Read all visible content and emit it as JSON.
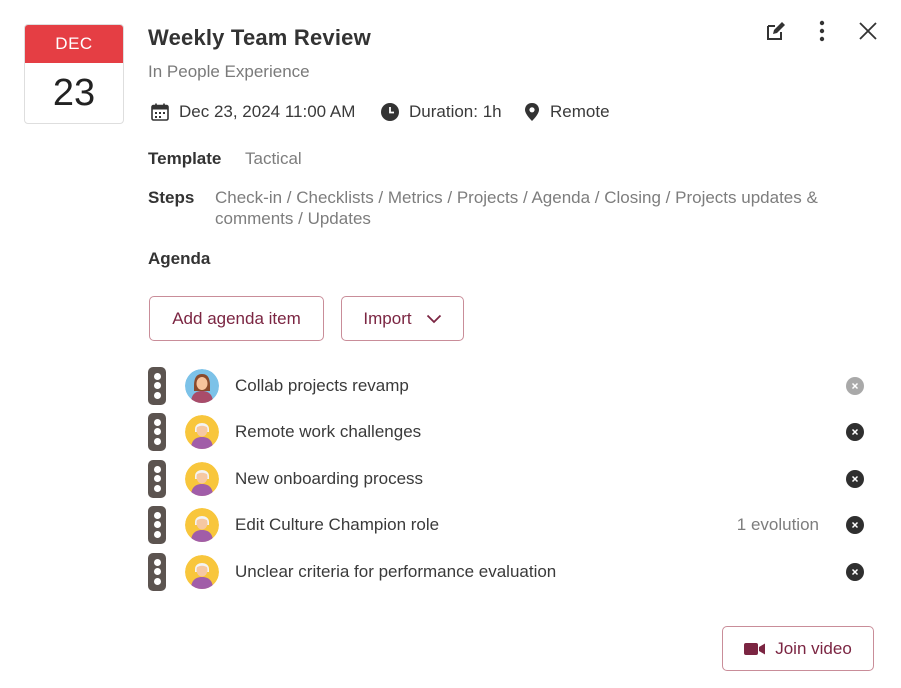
{
  "calendar": {
    "month": "DEC",
    "day": "23"
  },
  "meeting": {
    "title": "Weekly Team Review",
    "subtitle": "In People Experience",
    "datetime": "Dec 23, 2024 11:00 AM",
    "duration": "Duration: 1h",
    "location": "Remote"
  },
  "template": {
    "label": "Template",
    "value": "Tactical"
  },
  "steps": {
    "label": "Steps",
    "line1": "Check-in / Checklists / Metrics / Projects / Agenda / Closing / Projects updates &",
    "line2": "comments / Updates"
  },
  "agenda": {
    "label": "Agenda",
    "add_label": "Add agenda item",
    "import_label": "Import",
    "items": [
      {
        "title": "Collab projects revamp",
        "evolution": "",
        "avatar": "woman-avatar",
        "remove_state": "disabled"
      },
      {
        "title": "Remote work challenges",
        "evolution": "",
        "avatar": "elder-avatar",
        "remove_state": "active"
      },
      {
        "title": "New onboarding process",
        "evolution": "",
        "avatar": "elder-avatar",
        "remove_state": "active"
      },
      {
        "title": "Edit Culture Champion role",
        "evolution": "1 evolution",
        "avatar": "elder-avatar",
        "remove_state": "active"
      },
      {
        "title": "Unclear criteria for performance evaluation",
        "evolution": "",
        "avatar": "elder-avatar",
        "remove_state": "active"
      }
    ]
  },
  "join_video": {
    "label": "Join video"
  },
  "icons": [
    "edit-icon",
    "more-vertical-icon",
    "close-icon",
    "calendar-icon",
    "clock-icon",
    "location-pin-icon",
    "chevron-down-icon",
    "drag-handle-icon",
    "remove-icon",
    "video-camera-icon"
  ],
  "colors": {
    "accent": "#7b2542",
    "calendar_header": "#e53e44",
    "border": "#c98d99"
  }
}
